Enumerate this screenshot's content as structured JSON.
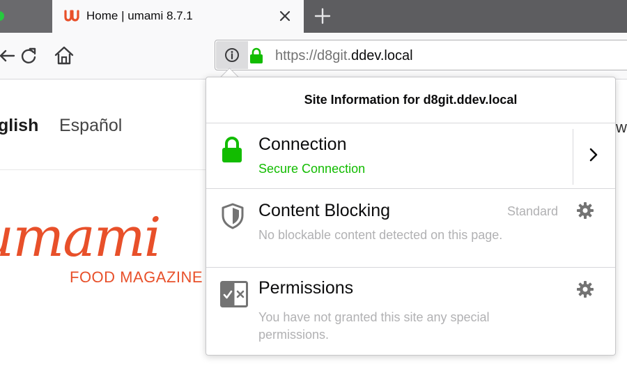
{
  "tab": {
    "favicon": "ս",
    "title": "Home | umami 8.7.1",
    "close_icon": "close-icon",
    "new_tab_icon": "plus-icon"
  },
  "toolbar": {
    "url_prefix": "https://d8git.",
    "url_domain": "ddev.local"
  },
  "page": {
    "lang_english": "glish",
    "lang_spanish": "Español",
    "logo_text": "umami",
    "logo_subtitle": "FOOD MAGAZINE",
    "right_edge_text": "wo"
  },
  "popup": {
    "header": "Site Information for d8git.ddev.local",
    "connection": {
      "title": "Connection",
      "status": "Secure Connection"
    },
    "content_blocking": {
      "title": "Content Blocking",
      "level": "Standard",
      "description": "No blockable content detected on this page."
    },
    "permissions": {
      "title": "Permissions",
      "description_line1": "You have not granted this site any special",
      "description_line2": "permissions."
    }
  },
  "colors": {
    "secure_green": "#12bc00",
    "brand_orange": "#e8502a",
    "tabstrip": "#5d5d60"
  }
}
